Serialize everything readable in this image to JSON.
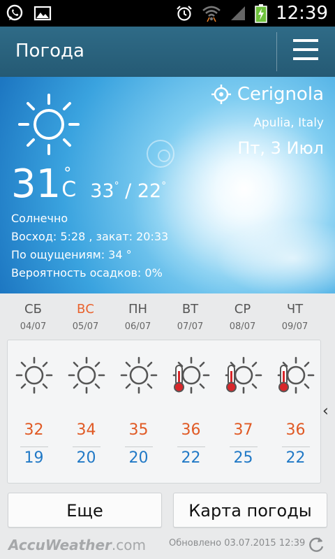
{
  "status_bar": {
    "time": "12:39",
    "icons": [
      "whatsapp-icon",
      "gallery-icon",
      "alarm-icon",
      "wifi-icon",
      "signal-icon",
      "battery-charging-icon"
    ]
  },
  "app_bar": {
    "title": "Погода",
    "menu_icon": "hamburger-menu-icon"
  },
  "current": {
    "city": "Cerignola",
    "region": "Apulia, Italy",
    "date": "Пт, 3 Июл",
    "temp": "31",
    "deg": "°",
    "unit": "C",
    "hi": "33",
    "lo": "22",
    "hi_lo_sep": " / ",
    "condition": "Солнечно",
    "sunrise_sunset": "Восход: 5:28 , закат: 20:33",
    "feels_like": "По ощущениям: 34 °",
    "precip": "Вероятность осадков: 0%",
    "icon": "sun-icon"
  },
  "forecast": [
    {
      "day": "СБ",
      "date": "04/07",
      "hi": "32",
      "lo": "19",
      "icon": "sun-icon",
      "weekend": false
    },
    {
      "day": "ВС",
      "date": "05/07",
      "hi": "34",
      "lo": "20",
      "icon": "sun-icon",
      "weekend": true
    },
    {
      "day": "ПН",
      "date": "06/07",
      "hi": "35",
      "lo": "20",
      "icon": "sun-icon",
      "weekend": false
    },
    {
      "day": "ВТ",
      "date": "07/07",
      "hi": "36",
      "lo": "22",
      "icon": "hot-sun-icon",
      "weekend": false
    },
    {
      "day": "СР",
      "date": "08/07",
      "hi": "37",
      "lo": "25",
      "icon": "hot-sun-icon",
      "weekend": false
    },
    {
      "day": "ЧТ",
      "date": "09/07",
      "hi": "36",
      "lo": "22",
      "icon": "hot-sun-icon",
      "weekend": false
    }
  ],
  "buttons": {
    "more": "Еще",
    "map": "Карта погоды"
  },
  "footer": {
    "logo_main": "AccuWeather",
    "logo_suffix": ".com",
    "updated": "Обновлено 03.07.2015 12:39"
  },
  "colors": {
    "hi": "#e05a25",
    "lo": "#2179c6",
    "app_bar": "#2f6b87",
    "weekend": "#e9622d"
  }
}
